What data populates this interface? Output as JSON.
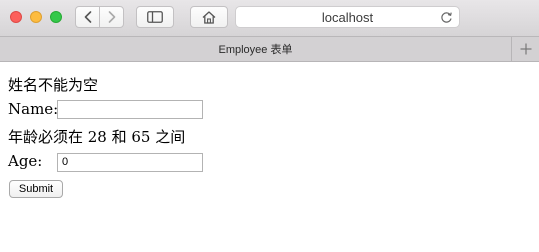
{
  "browser": {
    "address": "localhost",
    "tab_title": "Employee 表单",
    "icons": [
      "close-icon",
      "minimize-icon",
      "maximize-icon",
      "back-icon",
      "forward-icon",
      "sidebar-icon",
      "home-icon",
      "reload-icon",
      "plus-icon"
    ]
  },
  "form": {
    "name_error": "姓名不能为空",
    "name_label": "Name:",
    "name_value": "",
    "age_error": "年龄必须在 28 和 65 之间",
    "age_label": "Age:",
    "age_value": "0",
    "submit_label": "Submit"
  }
}
